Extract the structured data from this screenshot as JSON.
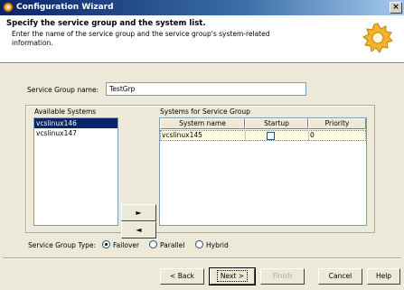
{
  "window": {
    "title": "Configuration Wizard",
    "close_label": "×"
  },
  "header": {
    "title": "Specify the service group and the system list.",
    "description": "Enter the name of the service group and the service group's system-related information."
  },
  "service_group": {
    "label": "Service Group name:",
    "value": "TestGrp"
  },
  "available_systems": {
    "label": "Available Systems",
    "items": [
      "vcslinux146",
      "vcslinux147"
    ],
    "selected": "vcslinux146"
  },
  "arrows": {
    "add": "►",
    "remove": "◄"
  },
  "systems_for_group": {
    "label": "Systems for Service Group",
    "columns": [
      "System name",
      "Startup",
      "Priority"
    ],
    "rows": [
      {
        "system_name": "vcslinux145",
        "startup": false,
        "priority": "0"
      }
    ]
  },
  "service_group_type": {
    "label": "Service Group Type:",
    "options": [
      "Failover",
      "Parallel",
      "Hybrid"
    ],
    "selected": "Failover"
  },
  "buttons": {
    "back": "< Back",
    "next": "Next >",
    "finish": "Finish",
    "cancel": "Cancel",
    "help": "Help"
  }
}
